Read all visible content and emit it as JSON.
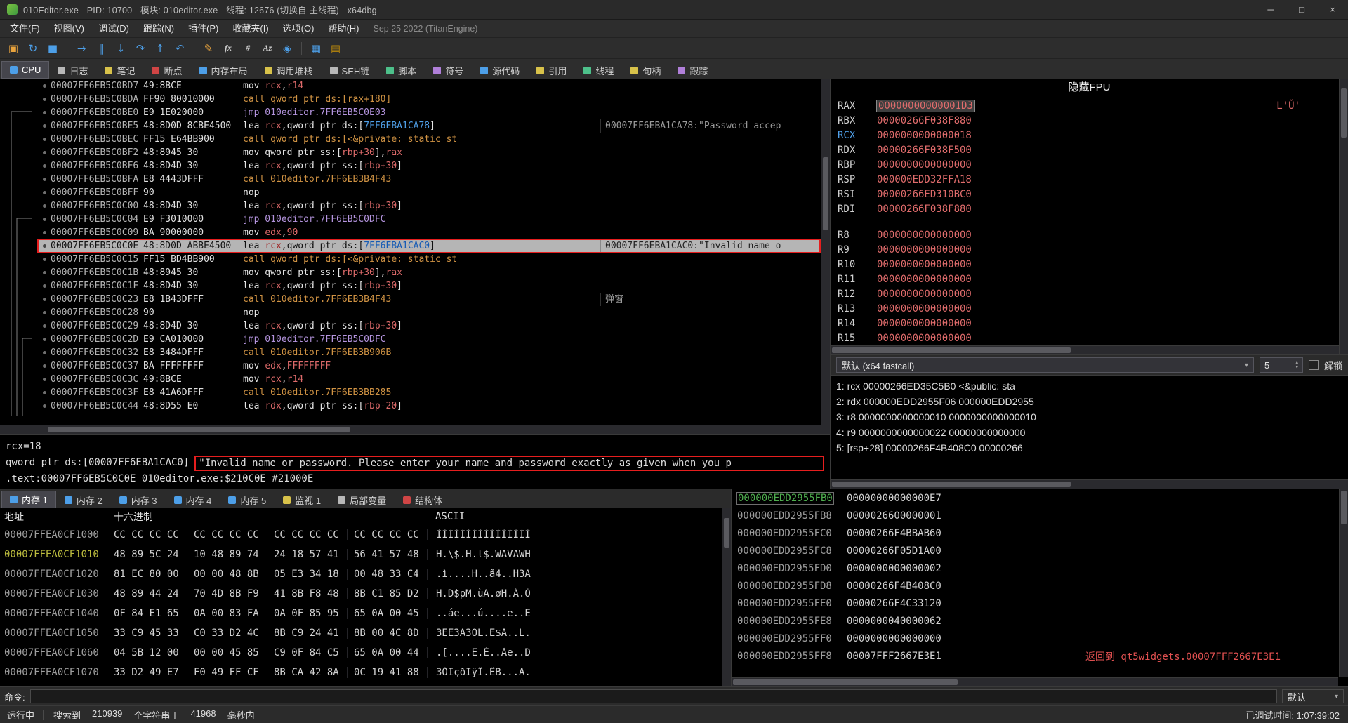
{
  "titlebar": {
    "title": "010Editor.exe - PID: 10700 - 模块: 010editor.exe - 线程: 12676 (切换自 主线程) - x64dbg",
    "minimize": "─",
    "maximize": "□",
    "close": "×"
  },
  "menubar": {
    "items": [
      "文件(F)",
      "视图(V)",
      "调试(D)",
      "跟踪(N)",
      "插件(P)",
      "收藏夹(I)",
      "选项(O)",
      "帮助(H)"
    ],
    "build_info": "Sep 25 2022 (TitanEngine)"
  },
  "toolbar": {
    "icons": [
      {
        "name": "open-file-icon",
        "glyph": "▣",
        "color": "#e8a33d"
      },
      {
        "name": "restart-icon",
        "glyph": "↻",
        "color": "#4d9fe8"
      },
      {
        "name": "stop-icon",
        "glyph": "■",
        "color": "#4d9fe8"
      },
      {
        "sep": true
      },
      {
        "name": "run-icon",
        "glyph": "→",
        "color": "#4d9fe8"
      },
      {
        "name": "pause-icon",
        "glyph": "‖",
        "color": "#4d9fe8"
      },
      {
        "name": "step-into-icon",
        "glyph": "↓",
        "color": "#4d9fe8"
      },
      {
        "name": "step-over-icon",
        "glyph": "↷",
        "color": "#4d9fe8"
      },
      {
        "name": "execute-till-return-icon",
        "glyph": "↑",
        "color": "#4d9fe8"
      },
      {
        "name": "step-back-icon",
        "glyph": "↶",
        "color": "#4d9fe8"
      },
      {
        "sep": true
      },
      {
        "name": "patch-icon",
        "glyph": "✎",
        "color": "#e8a33d"
      },
      {
        "name": "function-icon",
        "glyph": "fx",
        "color": "#cfcfcf",
        "txt": true
      },
      {
        "name": "hash-icon",
        "glyph": "#",
        "color": "#cfcfcf",
        "txt": true
      },
      {
        "name": "strings-icon",
        "glyph": "Az",
        "color": "#cfcfcf",
        "txt": true
      },
      {
        "name": "graph-icon",
        "glyph": "◈",
        "color": "#4d9fe8"
      },
      {
        "sep": true
      },
      {
        "name": "memory-icon",
        "glyph": "▦",
        "color": "#4d9fe8"
      },
      {
        "name": "book-icon",
        "glyph": "▤",
        "color": "#b8860b"
      }
    ]
  },
  "main_tabs": {
    "selected": 0,
    "items": [
      {
        "label": "CPU",
        "icon": "cpu-icon",
        "color": "#4d9fe8"
      },
      {
        "label": "日志",
        "icon": "log-icon",
        "color": "#b8b8b8"
      },
      {
        "label": "笔记",
        "icon": "notes-icon",
        "color": "#d8c24a"
      },
      {
        "label": "断点",
        "icon": "breakpoints-icon",
        "color": "#d04545"
      },
      {
        "label": "内存布局",
        "icon": "memory-map-icon",
        "color": "#4d9fe8"
      },
      {
        "label": "调用堆栈",
        "icon": "call-stack-icon",
        "color": "#d8c24a"
      },
      {
        "label": "SEH链",
        "icon": "seh-chain-icon",
        "color": "#b8b8b8"
      },
      {
        "label": "脚本",
        "icon": "script-icon",
        "color": "#4dc08a"
      },
      {
        "label": "符号",
        "icon": "symbols-icon",
        "color": "#b07fd9"
      },
      {
        "label": "源代码",
        "icon": "source-icon",
        "color": "#4d9fe8"
      },
      {
        "label": "引用",
        "icon": "references-icon",
        "color": "#d8c24a"
      },
      {
        "label": "线程",
        "icon": "threads-icon",
        "color": "#4dc08a"
      },
      {
        "label": "句柄",
        "icon": "handles-icon",
        "color": "#d8c24a"
      },
      {
        "label": "跟踪",
        "icon": "trace-icon",
        "color": "#b07fd9"
      }
    ]
  },
  "disasm": {
    "rows": [
      {
        "addr": "00007FF6EB5C0BD7",
        "bytes": "49:8BCE",
        "t": [
          [
            "mov ",
            "n"
          ],
          [
            "rcx",
            "r"
          ],
          [
            ",",
            "n"
          ],
          [
            "r14",
            "r"
          ]
        ],
        "c": ""
      },
      {
        "addr": "00007FF6EB5C0BDA",
        "bytes": "FF90 80010000",
        "t": [
          [
            "call qword ptr ds:[rax+180]",
            "o"
          ]
        ],
        "c": ""
      },
      {
        "addr": "00007FF6EB5C0BE0",
        "bytes": "E9 1E020000",
        "t": [
          [
            "jmp 010editor.7FF6EB5C0E03",
            "v"
          ]
        ],
        "c": ""
      },
      {
        "addr": "00007FF6EB5C0BE5",
        "bytes": "48:8D0D 8CBE4500",
        "t": [
          [
            "lea ",
            "n"
          ],
          [
            "rcx",
            "r"
          ],
          [
            ",qword ptr ds:[",
            "n"
          ],
          [
            "7FF6EBA1CA78",
            "b"
          ],
          [
            "]",
            "n"
          ]
        ],
        "c": "00007FF6EBA1CA78:\"Password accep"
      },
      {
        "addr": "00007FF6EB5C0BEC",
        "bytes": "FF15 E64BB900",
        "t": [
          [
            "call qword ptr ds:[<&private: static st",
            "o"
          ]
        ],
        "c": ""
      },
      {
        "addr": "00007FF6EB5C0BF2",
        "bytes": "48:8945 30",
        "t": [
          [
            "mov qword ptr ss:[",
            "n"
          ],
          [
            "rbp+30",
            "r"
          ],
          [
            "],",
            "n"
          ],
          [
            "rax",
            "r"
          ]
        ],
        "c": ""
      },
      {
        "addr": "00007FF6EB5C0BF6",
        "bytes": "48:8D4D 30",
        "t": [
          [
            "lea ",
            "n"
          ],
          [
            "rcx",
            "r"
          ],
          [
            ",qword ptr ss:[",
            "n"
          ],
          [
            "rbp+30",
            "r"
          ],
          [
            "]",
            "n"
          ]
        ],
        "c": ""
      },
      {
        "addr": "00007FF6EB5C0BFA",
        "bytes": "E8 4443DFFF",
        "t": [
          [
            "call 010editor.7FF6EB3B4F43",
            "o"
          ]
        ],
        "c": ""
      },
      {
        "addr": "00007FF6EB5C0BFF",
        "bytes": "90",
        "t": [
          [
            "nop",
            "n"
          ]
        ],
        "c": ""
      },
      {
        "addr": "00007FF6EB5C0C00",
        "bytes": "48:8D4D 30",
        "t": [
          [
            "lea ",
            "n"
          ],
          [
            "rcx",
            "r"
          ],
          [
            ",qword ptr ss:[",
            "n"
          ],
          [
            "rbp+30",
            "r"
          ],
          [
            "]",
            "n"
          ]
        ],
        "c": ""
      },
      {
        "addr": "00007FF6EB5C0C04",
        "bytes": "E9 F3010000",
        "t": [
          [
            "jmp 010editor.7FF6EB5C0DFC",
            "v"
          ]
        ],
        "c": ""
      },
      {
        "addr": "00007FF6EB5C0C09",
        "bytes": "BA 90000000",
        "t": [
          [
            "mov ",
            "n"
          ],
          [
            "edx",
            "r"
          ],
          [
            ",",
            "n"
          ],
          [
            "90",
            "r"
          ]
        ],
        "c": ""
      },
      {
        "addr": "00007FF6EB5C0C0E",
        "bytes": "48:8D0D ABBE4500",
        "t": [
          [
            "lea ",
            "n"
          ],
          [
            "rcx",
            "r"
          ],
          [
            ",qword ptr ds:[",
            "n"
          ],
          [
            "7FF6EBA1CAC0",
            "b"
          ],
          [
            "]",
            "n"
          ]
        ],
        "c": "00007FF6EBA1CAC0:\"Invalid name o",
        "hl": true
      },
      {
        "addr": "00007FF6EB5C0C15",
        "bytes": "FF15 BD4BB900",
        "t": [
          [
            "call qword ptr ds:[<&private: static st",
            "o"
          ]
        ],
        "c": ""
      },
      {
        "addr": "00007FF6EB5C0C1B",
        "bytes": "48:8945 30",
        "t": [
          [
            "mov qword ptr ss:[",
            "n"
          ],
          [
            "rbp+30",
            "r"
          ],
          [
            "],",
            "n"
          ],
          [
            "rax",
            "r"
          ]
        ],
        "c": ""
      },
      {
        "addr": "00007FF6EB5C0C1F",
        "bytes": "48:8D4D 30",
        "t": [
          [
            "lea ",
            "n"
          ],
          [
            "rcx",
            "r"
          ],
          [
            ",qword ptr ss:[",
            "n"
          ],
          [
            "rbp+30",
            "r"
          ],
          [
            "]",
            "n"
          ]
        ],
        "c": ""
      },
      {
        "addr": "00007FF6EB5C0C23",
        "bytes": "E8 1B43DFFF",
        "t": [
          [
            "call 010editor.7FF6EB3B4F43",
            "o"
          ]
        ],
        "c": "弹窗"
      },
      {
        "addr": "00007FF6EB5C0C28",
        "bytes": "90",
        "t": [
          [
            "nop",
            "n"
          ]
        ],
        "c": ""
      },
      {
        "addr": "00007FF6EB5C0C29",
        "bytes": "48:8D4D 30",
        "t": [
          [
            "lea ",
            "n"
          ],
          [
            "rcx",
            "r"
          ],
          [
            ",qword ptr ss:[",
            "n"
          ],
          [
            "rbp+30",
            "r"
          ],
          [
            "]",
            "n"
          ]
        ],
        "c": ""
      },
      {
        "addr": "00007FF6EB5C0C2D",
        "bytes": "E9 CA010000",
        "t": [
          [
            "jmp 010editor.7FF6EB5C0DFC",
            "v"
          ]
        ],
        "c": ""
      },
      {
        "addr": "00007FF6EB5C0C32",
        "bytes": "E8 3484DFFF",
        "t": [
          [
            "call 010editor.7FF6EB3B906B",
            "o"
          ]
        ],
        "c": ""
      },
      {
        "addr": "00007FF6EB5C0C37",
        "bytes": "BA FFFFFFFF",
        "t": [
          [
            "mov ",
            "n"
          ],
          [
            "edx",
            "r"
          ],
          [
            ",",
            "n"
          ],
          [
            "FFFFFFFF",
            "r"
          ]
        ],
        "c": ""
      },
      {
        "addr": "00007FF6EB5C0C3C",
        "bytes": "49:8BCE",
        "t": [
          [
            "mov ",
            "n"
          ],
          [
            "rcx",
            "r"
          ],
          [
            ",",
            "n"
          ],
          [
            "r14",
            "r"
          ]
        ],
        "c": ""
      },
      {
        "addr": "00007FF6EB5C0C3F",
        "bytes": "E8 41A6DFFF",
        "t": [
          [
            "call 010editor.7FF6EB3BB285",
            "o"
          ]
        ],
        "c": ""
      },
      {
        "addr": "00007FF6EB5C0C44",
        "bytes": "48:8D55 E0",
        "t": [
          [
            "lea ",
            "n"
          ],
          [
            "rdx",
            "r"
          ],
          [
            ",qword ptr ss:[",
            "n"
          ],
          [
            "rbp-20",
            "r"
          ],
          [
            "]",
            "n"
          ]
        ],
        "c": ""
      }
    ]
  },
  "registers": {
    "header": "隐藏FPU",
    "rows": [
      {
        "name": "RAX",
        "value": "00000000000001D3",
        "extra": "L'Ǔ'",
        "sel": true
      },
      {
        "name": "RBX",
        "value": "00000266F038F880"
      },
      {
        "name": "RCX",
        "value": "0000000000000018",
        "blue": true
      },
      {
        "name": "RDX",
        "value": "00000266F038F500"
      },
      {
        "name": "RBP",
        "value": "0000000000000000"
      },
      {
        "name": "RSP",
        "value": "000000EDD32FFA18"
      },
      {
        "name": "RSI",
        "value": "00000266ED310BC0"
      },
      {
        "name": "RDI",
        "value": "00000266F038F880"
      },
      {
        "gap": true
      },
      {
        "name": "R8",
        "value": "0000000000000000"
      },
      {
        "name": "R9",
        "value": "0000000000000000"
      },
      {
        "name": "R10",
        "value": "0000000000000000"
      },
      {
        "name": "R11",
        "value": "0000000000000000"
      },
      {
        "name": "R12",
        "value": "0000000000000000"
      },
      {
        "name": "R13",
        "value": "0000000000000000"
      },
      {
        "name": "R14",
        "value": "0000000000000000"
      },
      {
        "name": "R15",
        "value": "0000000000000000"
      }
    ],
    "calling_convention": "默认 (x64 fastcall)",
    "arg_count": "5",
    "unlock_label": "解锁",
    "args": [
      "1: rcx 00000266ED35C5B0 <&public: sta",
      "2: rdx 000000EDD2955F06 000000EDD2955",
      "3: r8 0000000000000010 0000000000000010",
      "4: r9 0000000000000022 00000000000000",
      "5: [rsp+28] 00000266F4B408C0 00000266"
    ]
  },
  "info_pane": {
    "line1": "rcx=18",
    "line2_prefix": "qword ptr ds:[00007FF6EBA1CAC0]",
    "line2_string": "\"Invalid name or password. Please enter your name and password exactly as given when you p",
    "line3": ".text:00007FF6EB5C0C0E 010editor.exe:$210C0E #21000E"
  },
  "dump_tabs": {
    "selected": 0,
    "items": [
      {
        "label": "内存 1",
        "icon": "memory-1-icon",
        "color": "#4d9fe8"
      },
      {
        "label": "内存 2",
        "icon": "memory-2-icon",
        "color": "#4d9fe8"
      },
      {
        "label": "内存 3",
        "icon": "memory-3-icon",
        "color": "#4d9fe8"
      },
      {
        "label": "内存 4",
        "icon": "memory-4-icon",
        "color": "#4d9fe8"
      },
      {
        "label": "内存 5",
        "icon": "memory-5-icon",
        "color": "#4d9fe8"
      },
      {
        "label": "监视 1",
        "icon": "watch-icon",
        "color": "#d8c24a"
      },
      {
        "label": "局部变量",
        "icon": "locals-icon",
        "color": "#b8b8b8"
      },
      {
        "label": "结构体",
        "icon": "struct-icon",
        "color": "#d04545"
      }
    ]
  },
  "dump": {
    "col_addr": "地址",
    "col_hex": "十六进制",
    "col_ascii": "ASCII",
    "rows": [
      {
        "addr": "00007FFEA0CF1000",
        "hex": [
          "CC CC CC CC",
          "CC CC CC CC",
          "CC CC CC CC",
          "CC CC CC CC"
        ],
        "ascii": "ÌÌÌÌÌÌÌÌÌÌÌÌÌÌÌÌ"
      },
      {
        "addr": "00007FFEA0CF1010",
        "hex": [
          "48 89 5C 24",
          "10 48 89 74",
          "24 18 57 41",
          "56 41 57 48"
        ],
        "ascii": "H.\\$.H.t$.WAVAWH",
        "sel": true
      },
      {
        "addr": "00007FFEA0CF1020",
        "hex": [
          "81 EC 80 00",
          "00 00 48 8B",
          "05 E3 34 18",
          "00 48 33 C4"
        ],
        "ascii": ".ì....H..ã4..H3Ä"
      },
      {
        "addr": "00007FFEA0CF1030",
        "hex": [
          "48 89 44 24",
          "70 4D 8B F9",
          "41 8B F8 48",
          "8B C1 85 D2"
        ],
        "ascii": "H.D$pM.ùA.øH.Á.Ò"
      },
      {
        "addr": "00007FFEA0CF1040",
        "hex": [
          "0F 84 E1 65",
          "0A 00 83 FA",
          "0A 0F 85 95",
          "65 0A 00 45"
        ],
        "ascii": "..áe...ú....e..E"
      },
      {
        "addr": "00007FFEA0CF1050",
        "hex": [
          "33 C9 45 33",
          "C0 33 D2 4C",
          "8B C9 24 41",
          "8B 00 4C 8D"
        ],
        "ascii": "3ÉE3À3ÒL.É$A..L."
      },
      {
        "addr": "00007FFEA0CF1060",
        "hex": [
          "04 5B 12 00",
          "00 00 45 85",
          "C9 0F 84 C5",
          "65 0A 00 44"
        ],
        "ascii": ".[....E.É..Åe..D"
      },
      {
        "addr": "00007FFEA0CF1070",
        "hex": [
          "33 D2 49 E7",
          "F0 49 FF CF",
          "8B CA 42 8A",
          "0C 19 41 88"
        ],
        "ascii": "3ÒIçðIÿÏ.ÊB...A."
      }
    ]
  },
  "stack": {
    "rows": [
      {
        "addr": "000000EDD2955FB0",
        "value": "00000000000000E7",
        "sel": true
      },
      {
        "addr": "000000EDD2955FB8",
        "value": "0000026600000001"
      },
      {
        "addr": "000000EDD2955FC0",
        "value": "00000266F4BBAB60"
      },
      {
        "addr": "000000EDD2955FC8",
        "value": "00000266F05D1A00"
      },
      {
        "addr": "000000EDD2955FD0",
        "value": "0000000000000002"
      },
      {
        "addr": "000000EDD2955FD8",
        "value": "00000266F4B408C0"
      },
      {
        "addr": "000000EDD2955FE0",
        "value": "00000266F4C33120"
      },
      {
        "addr": "000000EDD2955FE8",
        "value": "0000000040000062"
      },
      {
        "addr": "000000EDD2955FF0",
        "value": "0000000000000000"
      },
      {
        "addr": "000000EDD2955FF8",
        "value": "00007FFF2667E3E1",
        "comment": "返回到 qt5widgets.00007FFF2667E3E1"
      }
    ]
  },
  "command": {
    "label": "命令:",
    "value": "",
    "default_label": "默认"
  },
  "status": {
    "state": "运行中",
    "message_segments": [
      "搜索到",
      "210939",
      "个字符串于",
      "41968",
      "毫秒内"
    ],
    "right": "已调试时间: 1:07:39:02"
  }
}
